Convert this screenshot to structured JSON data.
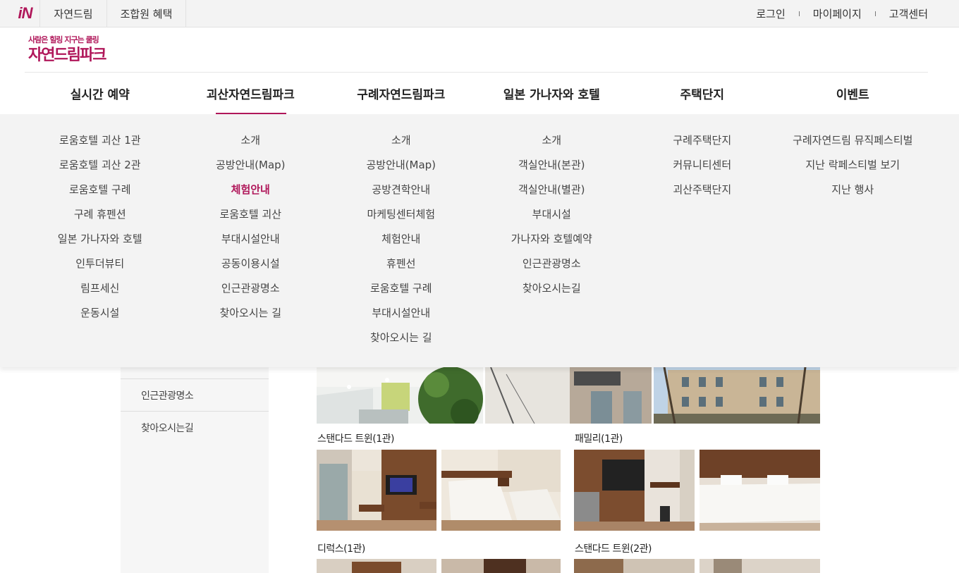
{
  "top": {
    "logo_text": "iN",
    "tabs": [
      "자연드림",
      "조합원 혜택"
    ],
    "links": [
      "로그인",
      "마이페이지",
      "고객센터"
    ]
  },
  "brand": {
    "slogan": "사람은 힐링 지구는 쿨링",
    "name": "자연드림파크"
  },
  "gnb": [
    {
      "label": "실시간 예약"
    },
    {
      "label": "괴산자연드림파크"
    },
    {
      "label": "구례자연드림파크"
    },
    {
      "label": "일본 가나자와 호텔"
    },
    {
      "label": "주택단지"
    },
    {
      "label": "이벤트"
    }
  ],
  "mega": [
    [
      "로움호텔 괴산 1관",
      "로움호텔 괴산 2관",
      "로움호텔 구례",
      "구례 휴펜션",
      "일본 가나자와 호텔",
      "인투더뷰티",
      "림프세신",
      "운동시설"
    ],
    [
      "소개",
      "공방안내(Map)",
      "체험안내",
      "로움호텔 괴산",
      "부대시설안내",
      "공동이용시설",
      "인근관광명소",
      "찾아오시는 길"
    ],
    [
      "소개",
      "공방안내(Map)",
      "공방견학안내",
      "마케팅센터체험",
      "체험안내",
      "휴펜선",
      "로움호텔 구례",
      "부대시설안내",
      "찾아오시는 길"
    ],
    [
      "소개",
      "객실안내(본관)",
      "객실안내(별관)",
      "부대시설",
      "가나자와 호텔예약",
      "인근관광명소",
      "찾아오시는길"
    ],
    [
      "구례주택단지",
      "커뮤니티센터",
      "괴산주택단지"
    ],
    [
      "구례자연드림 뮤직페스티벌",
      "지난 락페스티벌 보기",
      "지난 행사"
    ]
  ],
  "sidebar": [
    "인근관광명소",
    "찾아오시는길"
  ],
  "rooms": [
    "스탠다드 트윈(1관)",
    "패밀리(1관)",
    "디럭스(1관)",
    "스탠다드 트윈(2관)"
  ],
  "colors": {
    "accent": "#b0175a",
    "menu_bg": "#f3f3f3"
  }
}
